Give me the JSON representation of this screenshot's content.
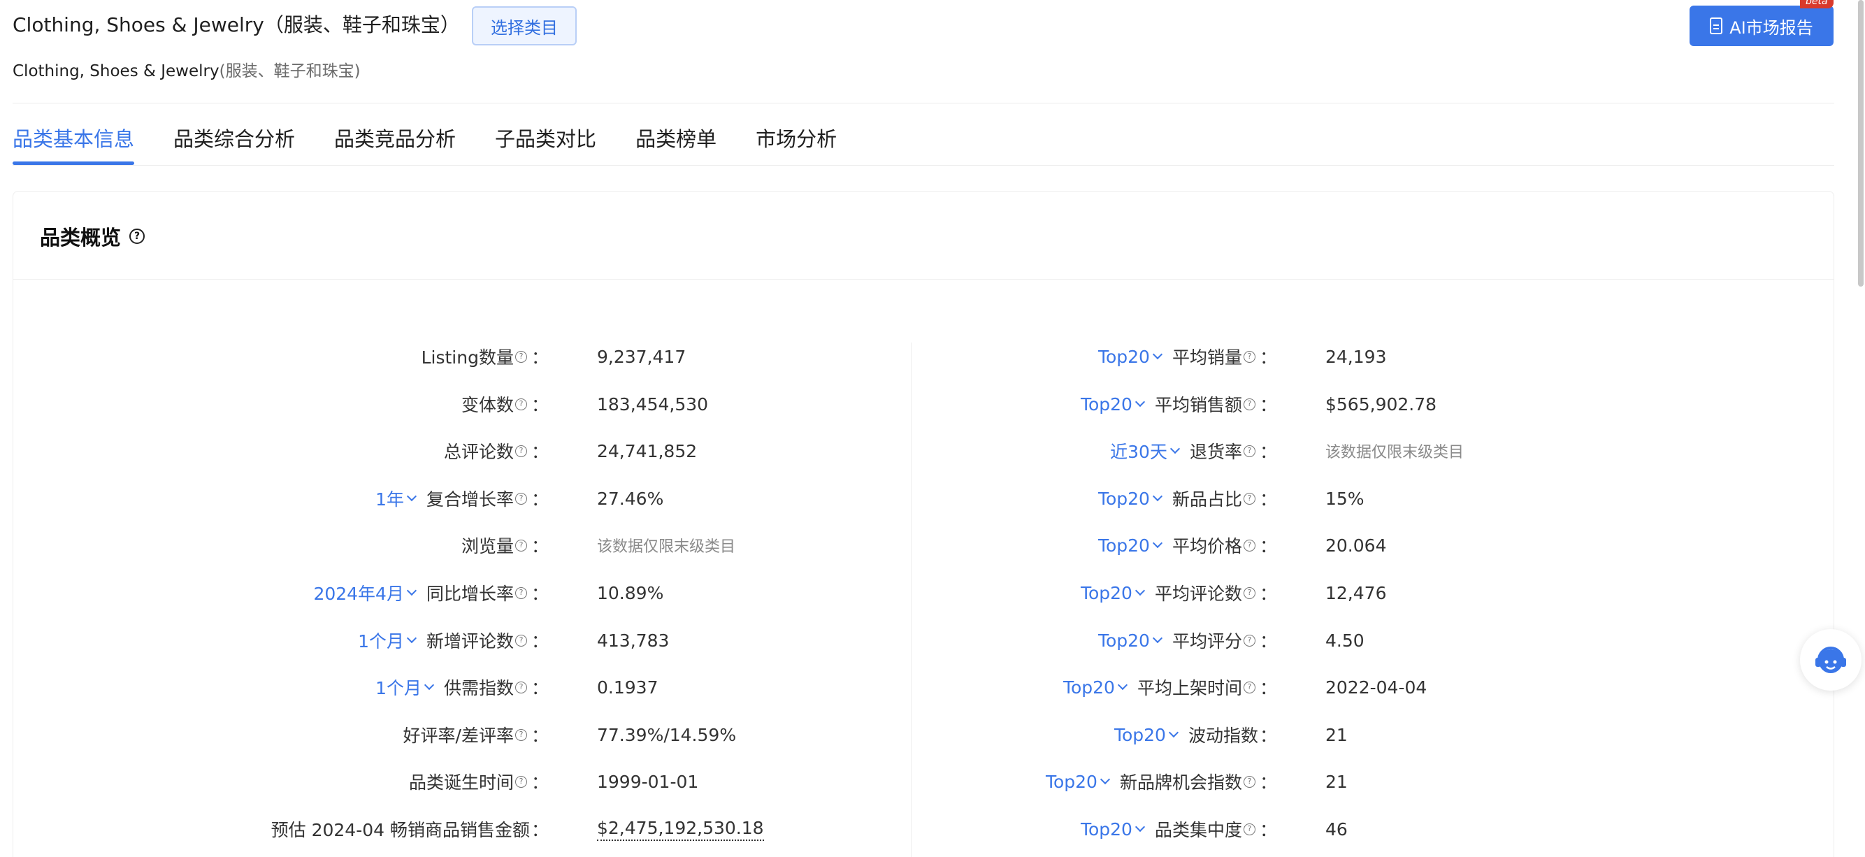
{
  "header": {
    "category_title": "Clothing, Shoes & Jewelry（服装、鞋子和珠宝）",
    "select_category_label": "选择类目",
    "subtitle_en": "Clothing, Shoes & Jewelry",
    "subtitle_zh": "(服装、鞋子和珠宝)",
    "ai_report_label": "AI市场报告",
    "beta_badge": "beta"
  },
  "tabs": [
    {
      "label": "品类基本信息",
      "active": true
    },
    {
      "label": "品类综合分析",
      "active": false
    },
    {
      "label": "品类竞品分析",
      "active": false
    },
    {
      "label": "子品类对比",
      "active": false
    },
    {
      "label": "品类榜单",
      "active": false
    },
    {
      "label": "市场分析",
      "active": false
    }
  ],
  "overview": {
    "title": "品类概览",
    "left": [
      {
        "label": "Listing数量",
        "value": "9,237,417"
      },
      {
        "label": "变体数",
        "value": "183,454,530"
      },
      {
        "label": "总评论数",
        "value": "24,741,852"
      },
      {
        "dropdown": "1年",
        "label": "复合增长率",
        "value": "27.46%"
      },
      {
        "label": "浏览量",
        "value": "该数据仅限末级类目"
      },
      {
        "dropdown": "2024年4月",
        "label": "同比增长率",
        "value": "10.89%"
      },
      {
        "dropdown": "1个月",
        "label": "新增评论数",
        "value": "413,783"
      },
      {
        "dropdown": "1个月",
        "label": "供需指数",
        "value": "0.1937"
      },
      {
        "label": "好评率/差评率",
        "value": "77.39%/14.59%"
      },
      {
        "label": "品类诞生时间",
        "value": "1999-01-01"
      },
      {
        "label": "预估 2024-04 畅销商品销售金额",
        "value": "$2,475,192,530.18"
      }
    ],
    "right": [
      {
        "dropdown": "Top20",
        "label": "平均销量",
        "value": "24,193"
      },
      {
        "dropdown": "Top20",
        "label": "平均销售额",
        "value": "$565,902.78"
      },
      {
        "dropdown": "近30天",
        "label": "退货率",
        "value": "该数据仅限末级类目"
      },
      {
        "dropdown": "Top20",
        "label": "新品占比",
        "value": "15%"
      },
      {
        "dropdown": "Top20",
        "label": "平均价格",
        "value": "20.064"
      },
      {
        "dropdown": "Top20",
        "label": "平均评论数",
        "value": "12,476"
      },
      {
        "dropdown": "Top20",
        "label": "平均评分",
        "value": "4.50"
      },
      {
        "dropdown": "Top20",
        "label": "平均上架时间",
        "value": "2022-04-04"
      },
      {
        "dropdown": "Top20",
        "label": "波动指数",
        "value": "21"
      },
      {
        "dropdown": "Top20",
        "label": "新品牌机会指数",
        "value": "21"
      },
      {
        "dropdown": "Top20",
        "label": "品类集中度",
        "value": "46"
      }
    ]
  },
  "colors": {
    "accent": "#3a76e8",
    "muted_text": "#8a8a8a",
    "beta_badge": "#d93a2b"
  }
}
